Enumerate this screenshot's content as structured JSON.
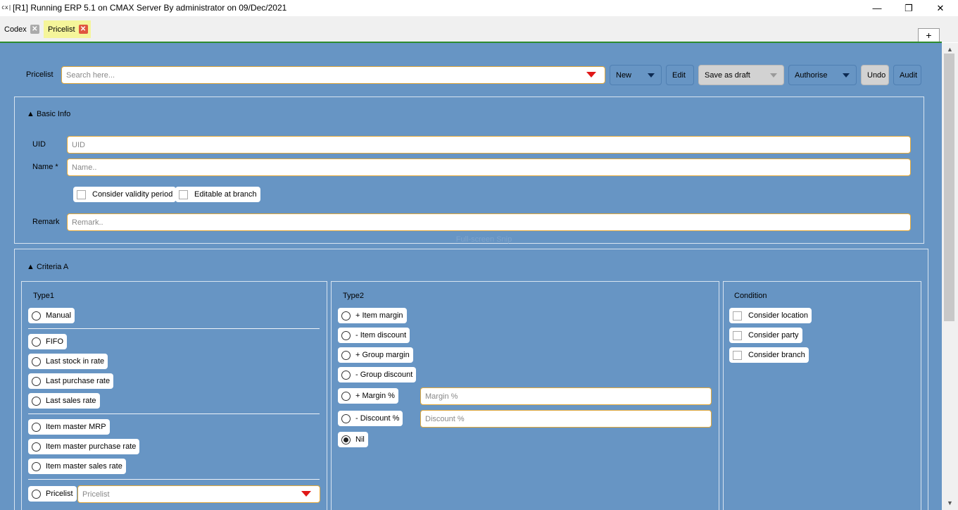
{
  "window": {
    "icon_text": "cx|",
    "title": "[R1] Running ERP 5.1 on CMAX Server By administrator on 09/Dec/2021",
    "minimize": "—",
    "maximize": "❐",
    "close": "✕"
  },
  "tabs": [
    {
      "label": "Codex",
      "close": "✕"
    },
    {
      "label": "Pricelist",
      "close": "✕"
    }
  ],
  "add_tab": "+",
  "toolbar": {
    "label": "Pricelist",
    "search_placeholder": "Search here...",
    "new": "New",
    "edit": "Edit",
    "save_draft": "Save as draft",
    "authorise": "Authorise",
    "undo": "Undo",
    "audit": "Audit"
  },
  "basic_info": {
    "title": "▲ Basic Info",
    "uid_label": "UID",
    "uid_placeholder": "UID",
    "name_label": "Name *",
    "name_placeholder": "Name..",
    "consider_validity": "Consider validity period",
    "editable_branch": "Editable at branch",
    "remark_label": "Remark",
    "remark_placeholder": "Remark.."
  },
  "watermark": "Full-screen Snip",
  "criteria": {
    "title": "▲ Criteria A",
    "type1": {
      "title": "Type1",
      "manual": "Manual",
      "fifo": "FIFO",
      "last_stock": "Last stock in rate",
      "last_purchase": "Last purchase rate",
      "last_sales": "Last sales rate",
      "item_mrp": "Item  master MRP",
      "item_purchase": "Item master purchase rate",
      "item_sales": "Item master sales rate",
      "pricelist": "Pricelist",
      "pricelist_placeholder": "Pricelist"
    },
    "type2": {
      "title": "Type2",
      "item_margin": "+ Item margin",
      "item_discount": "- Item discount",
      "group_margin": "+ Group margin",
      "group_discount": "- Group discount",
      "margin_pct": "+ Margin %",
      "margin_placeholder": "Margin %",
      "discount_pct": "- Discount %",
      "discount_placeholder": "Discount %",
      "nil": "Nil"
    },
    "condition": {
      "title": "Condition",
      "location": "Consider location",
      "party": "Consider party",
      "branch": "Consider branch"
    }
  },
  "colors": {
    "panel_bg": "#6795c4",
    "accent_border": "#e2a83a",
    "active_tab": "#f5f59a",
    "dropdown_arrow": "#e01818"
  }
}
